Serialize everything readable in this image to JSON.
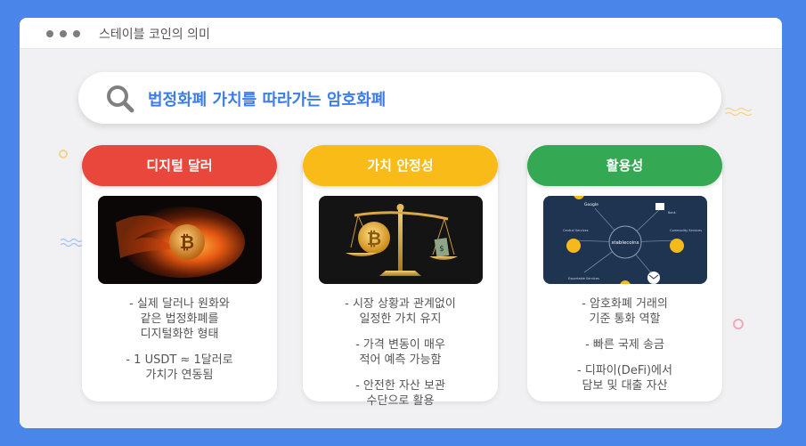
{
  "window": {
    "title": "스테이블 코인의 의미"
  },
  "search": {
    "text": "법정화폐 가치를 따라가는 암호화폐"
  },
  "colors": {
    "background": "#4a86ea",
    "red": "#e9463c",
    "yellow": "#f9bb17",
    "green": "#34a853",
    "accent": "#3c7de6"
  },
  "cards": [
    {
      "title": "디지털 달러",
      "image": "burning-bitcoin",
      "lines": [
        "- 실제 달러나 원화와",
        "같은 법정화폐를",
        "디지털화한 형태",
        "",
        "- 1 USDT ≈ 1달러로",
        "가치가 연동됨"
      ]
    },
    {
      "title": "가치 안정성",
      "image": "balance-scale-bitcoin-dollar",
      "lines": [
        "- 시장 상황과 관계없이",
        "일정한 가치 유지",
        "",
        "- 가격 변동이 매우",
        "적어 예측 가능함",
        "",
        "- 안전한 자산 보관",
        "수단으로 활용"
      ]
    },
    {
      "title": "활용성",
      "image": "stablecoins-network-diagram",
      "diagram": {
        "center": "stablecoins",
        "nodes": [
          "Google",
          "Bank",
          "Central Services",
          "Commodity Services",
          "Exportable Services"
        ]
      },
      "lines": [
        "- 암호화폐 거래의",
        "기준 통화 역할",
        "",
        "- 빠른 국제 송금",
        "",
        "- 디파이(DeFi)에서",
        "담보 및 대출 자산"
      ]
    }
  ]
}
